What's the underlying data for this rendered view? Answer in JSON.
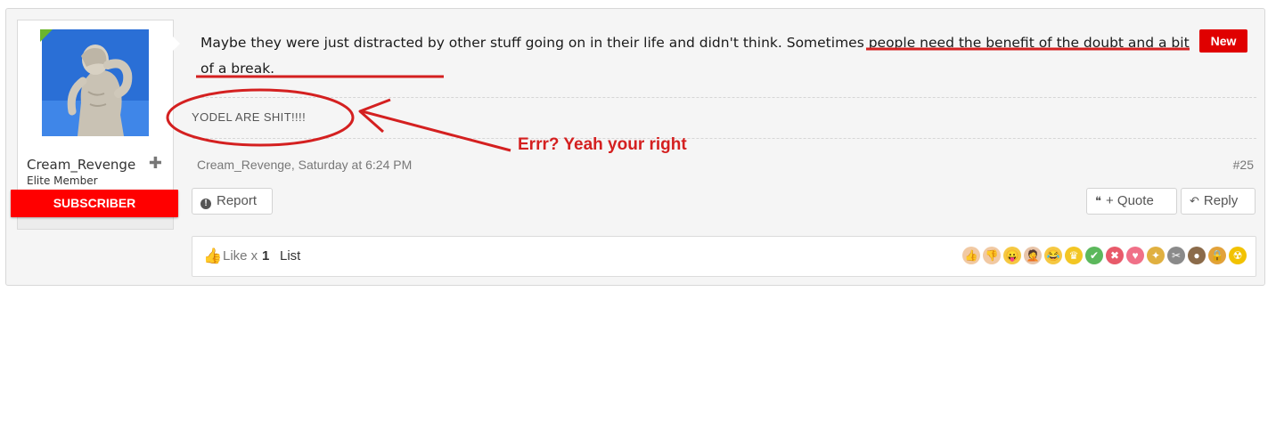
{
  "user": {
    "username": "Cream_Revenge",
    "title": "Elite Member",
    "badge": "SUBSCRIBER",
    "plus_glyph": "✚",
    "avatar_icon": "facepalm-statue-icon"
  },
  "post": {
    "text_plain": "Maybe they were just distracted by other stuff going on in their life and didn't think.",
    "text_highlight": " Sometimes people need the benefit of the doubt and a bit of a break.",
    "new_label": "New",
    "signature": "YODEL ARE SHIT!!!!",
    "meta": "Cream_Revenge, Saturday at 6:24 PM",
    "number": "#25"
  },
  "actions": {
    "report": "Report",
    "quote": "+ Quote",
    "reply": "Reply",
    "quote_glyph": "❝",
    "reply_glyph": "↶",
    "report_glyph": "!"
  },
  "likes": {
    "thumb_glyph": "👍",
    "label": "Like x",
    "count": "1",
    "list": "List"
  },
  "reactions": [
    {
      "icon": "like-icon",
      "glyph": "👍",
      "color": "#f1c9a3"
    },
    {
      "icon": "dislike-icon",
      "glyph": "👎",
      "color": "#f1c9a3"
    },
    {
      "icon": "tongue-face-icon",
      "glyph": "😛",
      "color": "#f5c842"
    },
    {
      "icon": "facepalm-icon",
      "glyph": "🤦",
      "color": "#e8c4a8"
    },
    {
      "icon": "laugh-icon",
      "glyph": "😂",
      "color": "#f5c842"
    },
    {
      "icon": "crown-icon",
      "glyph": "♛",
      "color": "#f3c623"
    },
    {
      "icon": "check-icon",
      "glyph": "✔",
      "color": "#5cb85c"
    },
    {
      "icon": "cross-icon",
      "glyph": "✖",
      "color": "#e85a6a"
    },
    {
      "icon": "heart-icon",
      "glyph": "♥",
      "color": "#f07088"
    },
    {
      "icon": "medal-icon",
      "glyph": "✦",
      "color": "#e0b040"
    },
    {
      "icon": "tools-icon",
      "glyph": "✂",
      "color": "#8a8a8a"
    },
    {
      "icon": "poop-icon",
      "glyph": "●",
      "color": "#8b6b4a"
    },
    {
      "icon": "lock-icon",
      "glyph": "🔒",
      "color": "#e2a23a"
    },
    {
      "icon": "radioactive-icon",
      "glyph": "☢",
      "color": "#f2c200"
    }
  ],
  "annotation": {
    "text": "Errr? Yeah your right",
    "color": "#d42020"
  }
}
